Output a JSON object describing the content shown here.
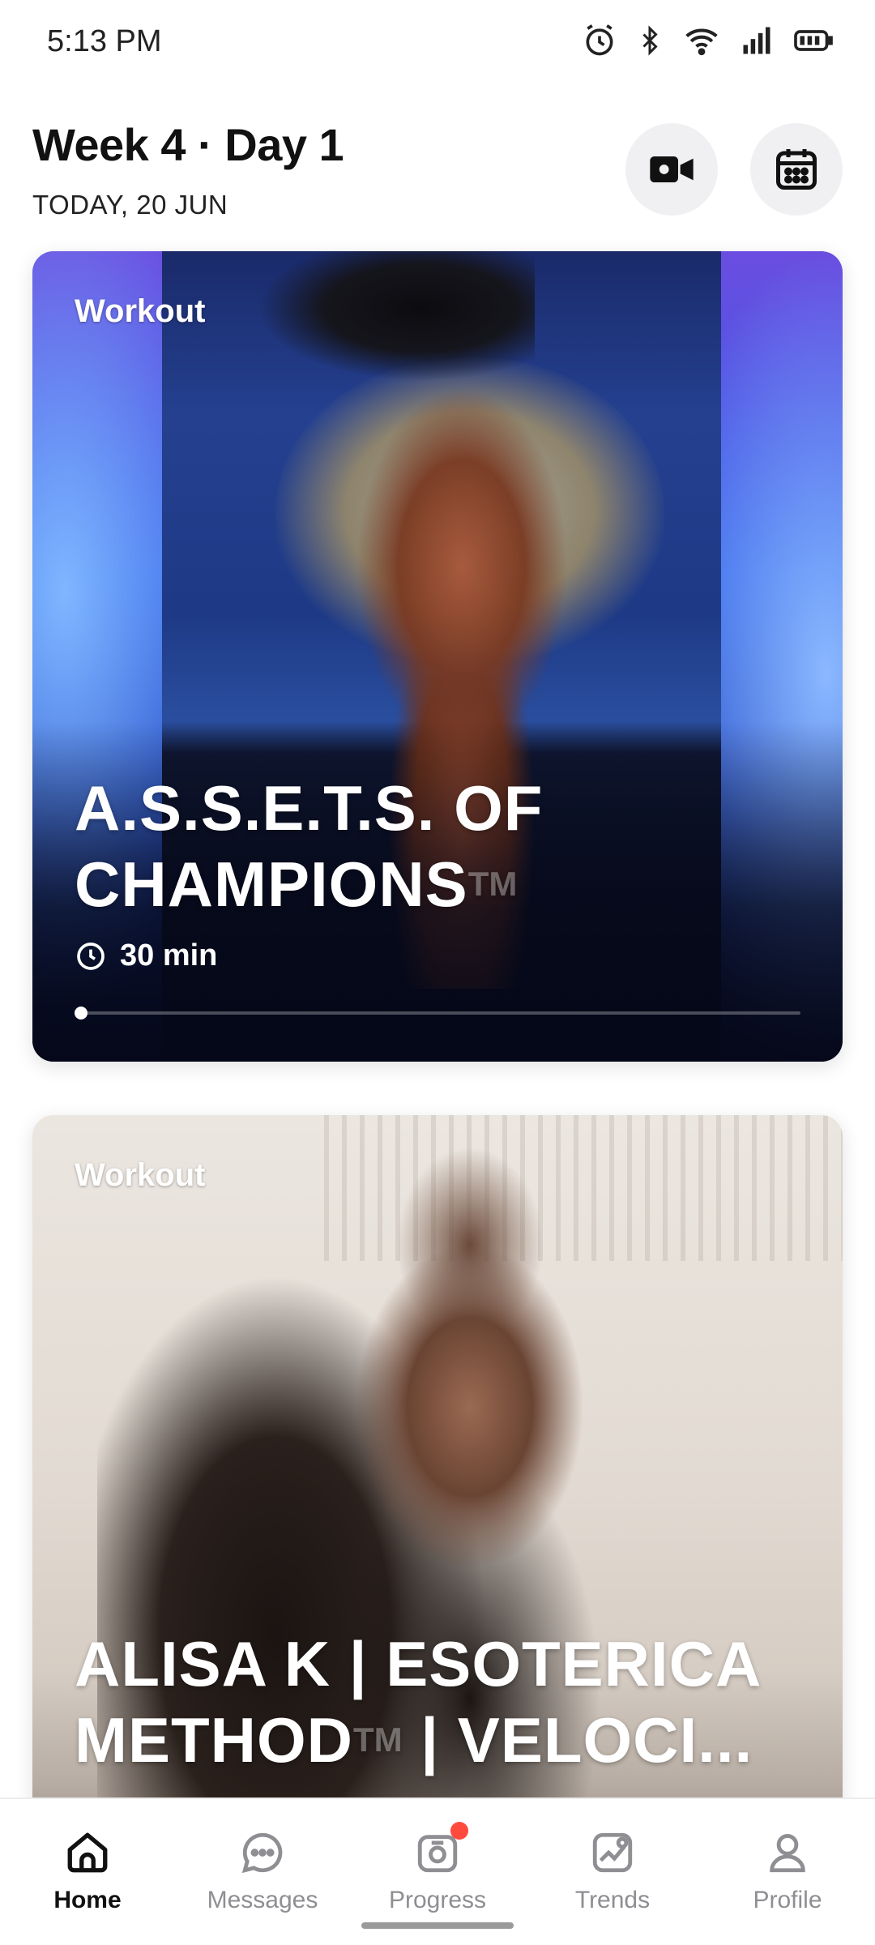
{
  "status_bar": {
    "time": "5:13 PM",
    "icons": [
      "alarm-icon",
      "bluetooth-icon",
      "wifi-icon",
      "signal-icon",
      "battery-icon"
    ]
  },
  "header": {
    "title": "Week 4 · Day 1",
    "date": "TODAY, 20 JUN",
    "buttons": [
      "video-camera-icon",
      "calendar-icon"
    ]
  },
  "cards": [
    {
      "tag": "Workout",
      "title": "A.S.S.E.T.S. OF CHAMPIONS",
      "trademark": "TM",
      "duration": "30 min",
      "progress": 0.0
    },
    {
      "tag": "Workout",
      "title_line1": "ALISA K | ESOTERICA",
      "title_line2_a": "METHOD",
      "trademark": "TM",
      "title_line2_b": " | VELOCI..."
    }
  ],
  "bottom_nav": {
    "items": [
      {
        "label": "Home",
        "icon": "home-icon",
        "active": true
      },
      {
        "label": "Messages",
        "icon": "chat-icon",
        "active": false
      },
      {
        "label": "Progress",
        "icon": "camera-icon",
        "active": false,
        "badge": true
      },
      {
        "label": "Trends",
        "icon": "trend-chart-icon",
        "active": false
      },
      {
        "label": "Profile",
        "icon": "person-icon",
        "active": false
      }
    ]
  },
  "colors": {
    "accent_dark": "#111111",
    "inactive": "#8e8e93",
    "badge": "#ff4b3e",
    "round_button_bg": "#f0f0f2"
  }
}
